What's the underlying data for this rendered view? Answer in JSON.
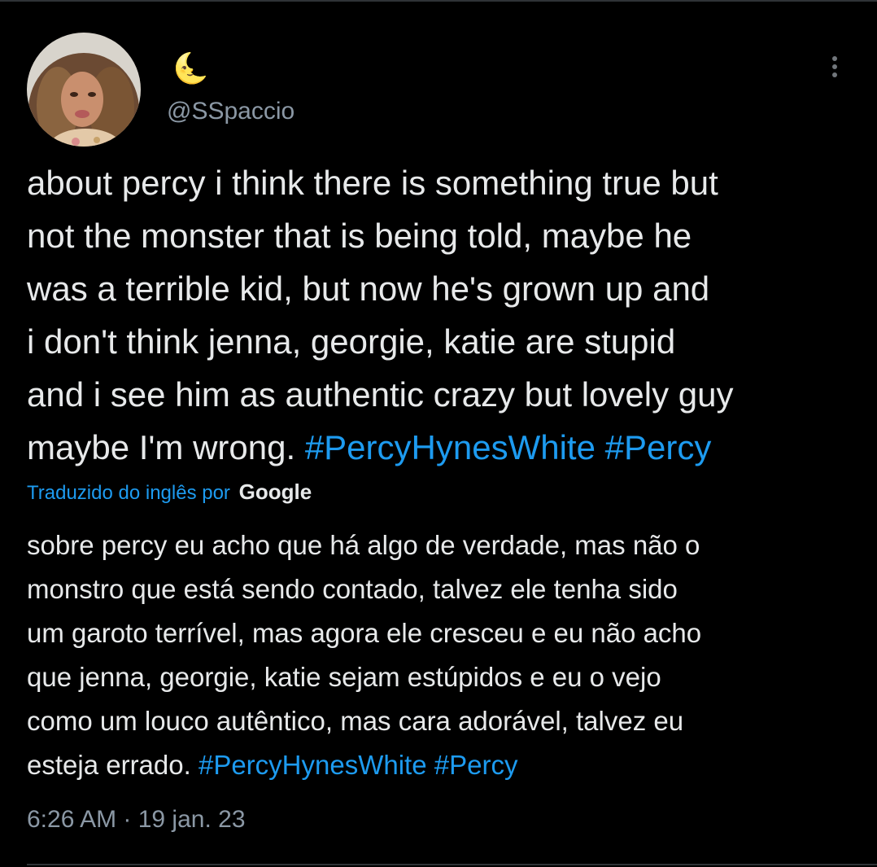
{
  "tweet": {
    "display_name": "🌜",
    "handle": "@SSpaccio",
    "avatar_icon": "profile-photo",
    "more_icon": "more-options-icon",
    "text_lines": [
      "about percy i think there is something true but",
      "not the monster that is being told, maybe he",
      "was a terrible kid, but now he's grown up and",
      "i don't think jenna, georgie, katie are stupid",
      "and i see him as authentic crazy but lovely guy",
      "maybe I'm wrong."
    ],
    "hashtags": [
      "#PercyHynesWhite",
      "#Percy"
    ],
    "translation_label": "Traduzido do inglês por",
    "translation_provider": "Google",
    "translated_lines": [
      "sobre percy eu acho que há algo de verdade, mas não o",
      "monstro que está sendo contado, talvez ele tenha sido",
      "um garoto terrível, mas agora ele cresceu e eu não acho",
      "que jenna, georgie, katie sejam estúpidos e eu o vejo",
      "como um louco autêntico, mas cara adorável, talvez eu",
      "esteja errado."
    ],
    "translated_hashtags": [
      "#PercyHynesWhite",
      "#Percy"
    ],
    "timestamp": "6:26 AM · 19 jan. 23"
  },
  "colors": {
    "background": "#000000",
    "text": "#e7e9ea",
    "secondary": "#8b98a5",
    "link": "#1d9bf0",
    "divider": "#2f3336"
  }
}
